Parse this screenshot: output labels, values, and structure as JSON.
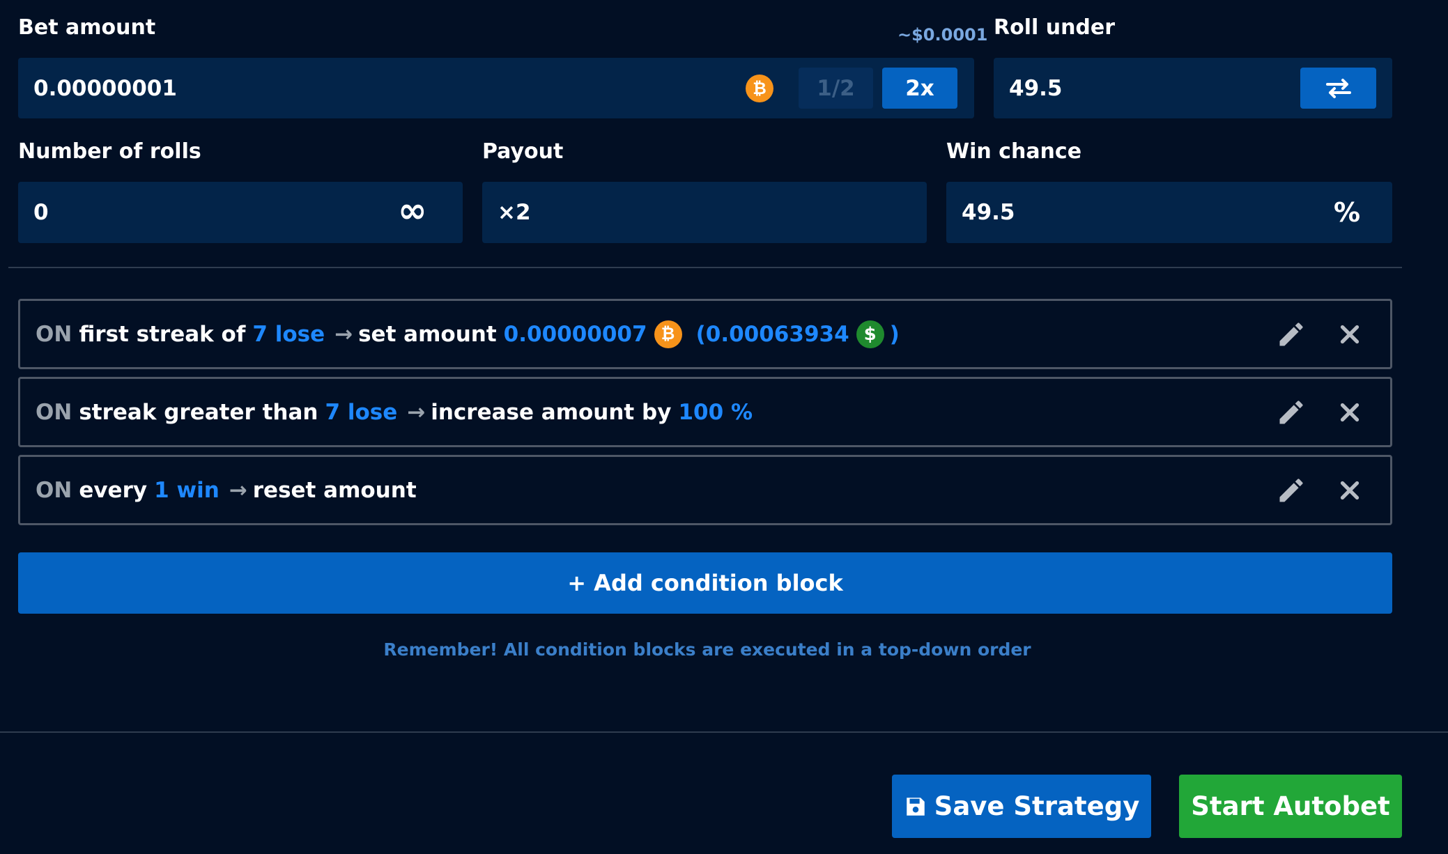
{
  "bet_amount": {
    "label": "Bet amount",
    "usd_estimate": "~$0.0001",
    "value": "0.00000001",
    "currency_icon": "bitcoin-icon",
    "half_label": "1/2",
    "double_label": "2x"
  },
  "roll_under": {
    "label": "Roll under",
    "value": "49.5",
    "swap_icon": "swap-arrows-icon"
  },
  "number_of_rolls": {
    "label": "Number of rolls",
    "value": "0",
    "infinity_symbol": "∞"
  },
  "payout": {
    "label": "Payout",
    "value": "×2"
  },
  "win_chance": {
    "label": "Win chance",
    "value": "49.5",
    "unit": "%"
  },
  "conditions": [
    {
      "on": "ON",
      "trigger_text": "first streak of",
      "trigger_value": "7 lose",
      "arrow": "→",
      "action_text": "set amount",
      "action_value": "0.00000007",
      "paren_open": "(0.00063934",
      "paren_close": ")"
    },
    {
      "on": "ON",
      "trigger_text": "streak greater than",
      "trigger_value": "7 lose",
      "arrow": "→",
      "action_text": "increase amount by",
      "action_value": "100 %"
    },
    {
      "on": "ON",
      "trigger_text": "every",
      "trigger_value": "1 win",
      "arrow": "→",
      "action_text": "reset amount"
    }
  ],
  "add_condition_label": "+ Add condition block",
  "note": "Remember! All condition blocks are executed in a top-down order",
  "save_strategy_label": "Save Strategy",
  "start_autobet_label": "Start Autobet",
  "colors": {
    "background": "#020f24",
    "field": "#032449",
    "accent_blue": "#0563c1",
    "highlight": "#1e88ff",
    "bitcoin": "#f7931a",
    "green": "#22a738"
  }
}
